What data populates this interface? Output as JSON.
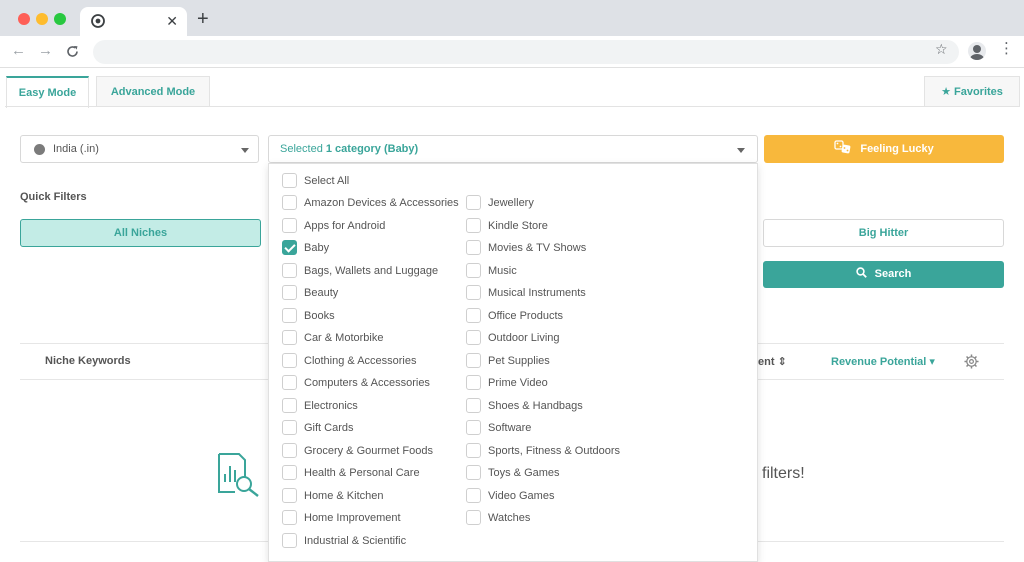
{
  "browser": {
    "tab_close": "✕",
    "new_tab": "+",
    "back": "←",
    "forward": "→",
    "reload": "C",
    "bookmark_star": "☆",
    "menu": "⋮"
  },
  "tabs": {
    "easy": "Easy Mode",
    "advanced": "Advanced Mode",
    "favorites": "Favorites",
    "favorites_icon": "★"
  },
  "filters": {
    "country": "India (.in)",
    "category_prefix": "Selected ",
    "category_count": "1 category (Baby)",
    "feeling_lucky": "Feeling Lucky",
    "quick_filters": "Quick Filters",
    "all_niches": "All Niches",
    "big_hitter": "Big Hitter",
    "search": "Search",
    "search_icon": "🔍"
  },
  "table": {
    "col_keywords": "Niche Keywords",
    "col_partial": "ent ⇕",
    "col_revenue": "Revenue Potential ▾"
  },
  "empty_state": {
    "text": "filters!"
  },
  "dropdown": {
    "select_all": "Select All",
    "col1": [
      {
        "label": "Amazon Devices & Accessories",
        "checked": false
      },
      {
        "label": "Apps for Android",
        "checked": false
      },
      {
        "label": "Baby",
        "checked": true
      },
      {
        "label": "Bags, Wallets and Luggage",
        "checked": false
      },
      {
        "label": "Beauty",
        "checked": false
      },
      {
        "label": "Books",
        "checked": false
      },
      {
        "label": "Car & Motorbike",
        "checked": false
      },
      {
        "label": "Clothing & Accessories",
        "checked": false
      },
      {
        "label": "Computers & Accessories",
        "checked": false
      },
      {
        "label": "Electronics",
        "checked": false
      },
      {
        "label": "Gift Cards",
        "checked": false
      },
      {
        "label": "Grocery & Gourmet Foods",
        "checked": false
      },
      {
        "label": "Health & Personal Care",
        "checked": false
      },
      {
        "label": "Home & Kitchen",
        "checked": false
      },
      {
        "label": "Home Improvement",
        "checked": false
      },
      {
        "label": "Industrial & Scientific",
        "checked": false
      }
    ],
    "col2": [
      {
        "label": "Jewellery",
        "checked": false
      },
      {
        "label": "Kindle Store",
        "checked": false
      },
      {
        "label": "Movies & TV Shows",
        "checked": false
      },
      {
        "label": "Music",
        "checked": false
      },
      {
        "label": "Musical Instruments",
        "checked": false
      },
      {
        "label": "Office Products",
        "checked": false
      },
      {
        "label": "Outdoor Living",
        "checked": false
      },
      {
        "label": "Pet Supplies",
        "checked": false
      },
      {
        "label": "Prime Video",
        "checked": false
      },
      {
        "label": "Shoes & Handbags",
        "checked": false
      },
      {
        "label": "Software",
        "checked": false
      },
      {
        "label": "Sports, Fitness & Outdoors",
        "checked": false
      },
      {
        "label": "Toys & Games",
        "checked": false
      },
      {
        "label": "Video Games",
        "checked": false
      },
      {
        "label": "Watches",
        "checked": false
      }
    ]
  },
  "colors": {
    "accent": "#3aa59a",
    "lucky": "#f8b83c",
    "all_niches_bg": "#c3ece6"
  }
}
